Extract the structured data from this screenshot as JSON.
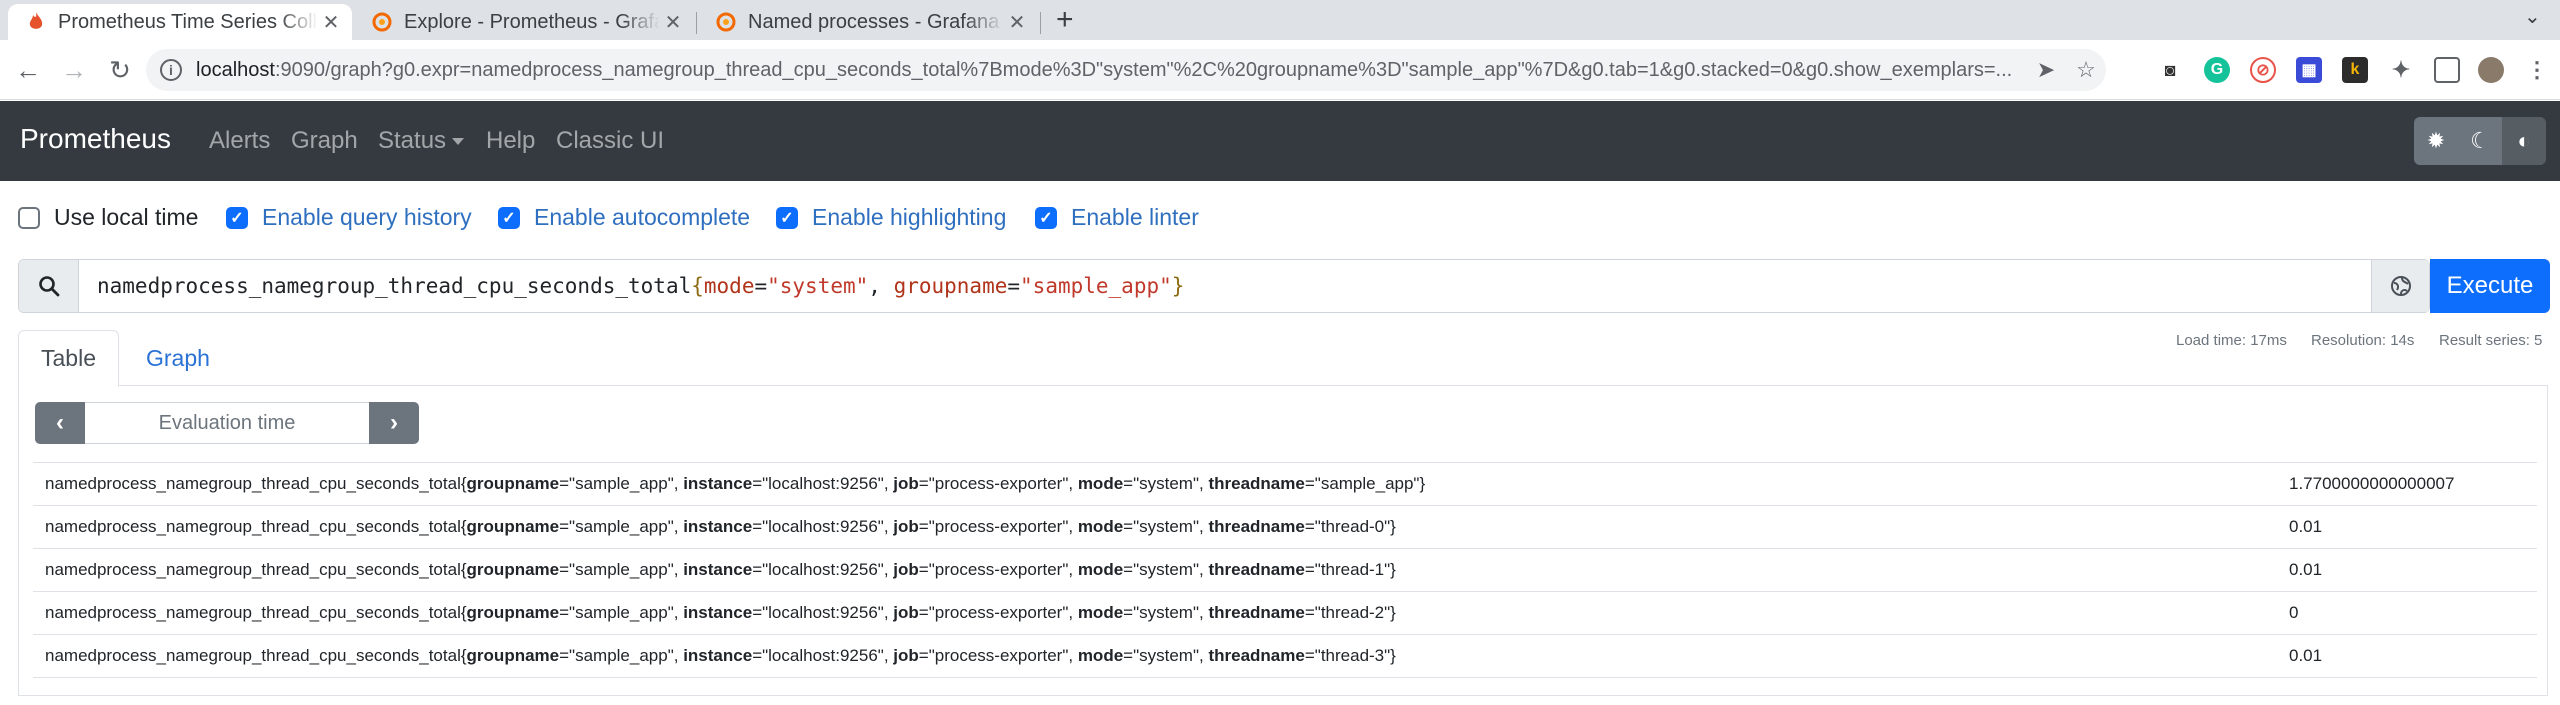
{
  "browser": {
    "tabs": [
      {
        "title": "Prometheus Time Series Collection and Processing Server",
        "active": true
      },
      {
        "title": "Explore - Prometheus - Grafana",
        "active": false
      },
      {
        "title": "Named processes - Grafana",
        "active": false
      }
    ],
    "url_host": "localhost",
    "url_rest": ":9090/graph?g0.expr=namedprocess_namegroup_thread_cpu_seconds_total%7Bmode%3D\"system\"%2C%20groupname%3D\"sample_app\"%7D&g0.tab=1&g0.stacked=0&g0.show_exemplars=..."
  },
  "navbar": {
    "brand": "Prometheus",
    "links": [
      "Alerts",
      "Graph",
      "Status",
      "Help",
      "Classic UI"
    ]
  },
  "options": [
    {
      "label": "Use local time",
      "checked": false
    },
    {
      "label": "Enable query history",
      "checked": true
    },
    {
      "label": "Enable autocomplete",
      "checked": true
    },
    {
      "label": "Enable highlighting",
      "checked": true
    },
    {
      "label": "Enable linter",
      "checked": true
    }
  ],
  "query": {
    "metric": "namedprocess_namegroup_thread_cpu_seconds_total",
    "open_brace": "{",
    "label1": "mode",
    "eq1": "=",
    "value1": "\"system\"",
    "sep": ", ",
    "label2": "groupname",
    "eq2": "=",
    "value2": "\"sample_app\"",
    "close_brace": "}",
    "execute_label": "Execute"
  },
  "panel": {
    "tabs": [
      "Table",
      "Graph"
    ],
    "active_tab": "Table",
    "load_time": "Load time: 17ms",
    "resolution": "Resolution: 14s",
    "result_series": "Result series: 5",
    "eval_placeholder": "Evaluation time"
  },
  "results": [
    {
      "metric": "namedprocess_namegroup_thread_cpu_seconds_total",
      "groupname": "\"sample_app\"",
      "instance": "\"localhost:9256\"",
      "job": "\"process-exporter\"",
      "mode": "\"system\"",
      "threadname": "\"sample_app\"",
      "value": "1.7700000000000007"
    },
    {
      "metric": "namedprocess_namegroup_thread_cpu_seconds_total",
      "groupname": "\"sample_app\"",
      "instance": "\"localhost:9256\"",
      "job": "\"process-exporter\"",
      "mode": "\"system\"",
      "threadname": "\"thread-0\"",
      "value": "0.01"
    },
    {
      "metric": "namedprocess_namegroup_thread_cpu_seconds_total",
      "groupname": "\"sample_app\"",
      "instance": "\"localhost:9256\"",
      "job": "\"process-exporter\"",
      "mode": "\"system\"",
      "threadname": "\"thread-1\"",
      "value": "0.01"
    },
    {
      "metric": "namedprocess_namegroup_thread_cpu_seconds_total",
      "groupname": "\"sample_app\"",
      "instance": "\"localhost:9256\"",
      "job": "\"process-exporter\"",
      "mode": "\"system\"",
      "threadname": "\"thread-2\"",
      "value": "0"
    },
    {
      "metric": "namedprocess_namegroup_thread_cpu_seconds_total",
      "groupname": "\"sample_app\"",
      "instance": "\"localhost:9256\"",
      "job": "\"process-exporter\"",
      "mode": "\"system\"",
      "threadname": "\"thread-3\"",
      "value": "0.01"
    }
  ],
  "label_names": {
    "groupname": "groupname",
    "instance": "instance",
    "job": "job",
    "mode": "mode",
    "threadname": "threadname"
  }
}
